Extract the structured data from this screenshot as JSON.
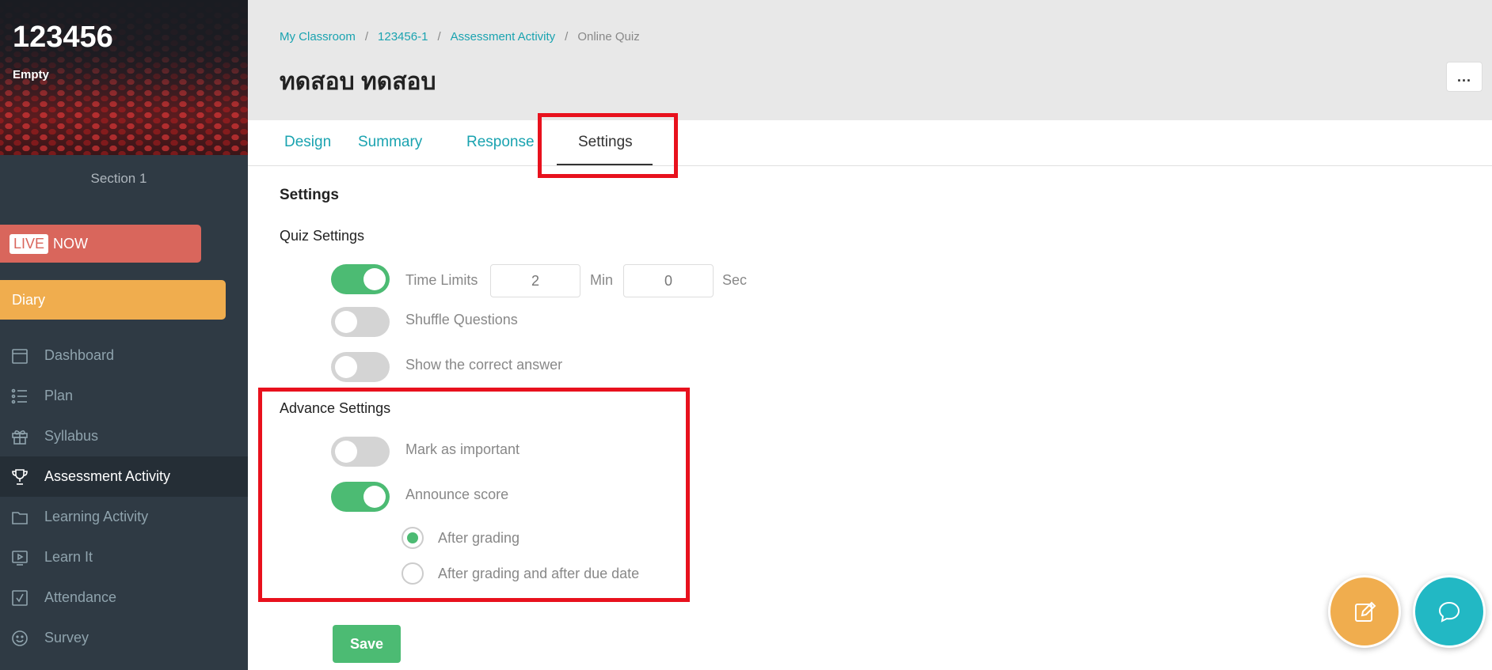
{
  "sidebar": {
    "course_code": "123456",
    "course_subtitle": "Empty",
    "section": "Section 1",
    "live": {
      "tag": "LIVE",
      "label": "NOW",
      "color": "#d9665c"
    },
    "diary": {
      "label": "Diary",
      "color": "#f0ad4e"
    },
    "nav": [
      {
        "label": "Dashboard",
        "icon": "calendar-icon"
      },
      {
        "label": "Plan",
        "icon": "list-icon"
      },
      {
        "label": "Syllabus",
        "icon": "gift-icon"
      },
      {
        "label": "Assessment Activity",
        "icon": "trophy-icon",
        "active": true
      },
      {
        "label": "Learning Activity",
        "icon": "folder-icon"
      },
      {
        "label": "Learn It",
        "icon": "play-icon"
      },
      {
        "label": "Attendance",
        "icon": "checkbox-icon"
      },
      {
        "label": "Survey",
        "icon": "smiley-icon"
      }
    ]
  },
  "header": {
    "breadcrumb": [
      "My Classroom",
      "123456-1",
      "Assessment Activity",
      "Online Quiz"
    ],
    "title": "ทดสอบ ทดสอบ",
    "more_label": "..."
  },
  "tabs": [
    {
      "label": "Design"
    },
    {
      "label": "Summary"
    },
    {
      "label": "Response"
    },
    {
      "label": "Settings",
      "active": true
    }
  ],
  "settings": {
    "heading": "Settings",
    "quiz_heading": "Quiz Settings",
    "time_limits": {
      "label": "Time Limits",
      "enabled": true,
      "minutes": "2",
      "min_unit": "Min",
      "seconds": "0",
      "sec_unit": "Sec"
    },
    "shuffle": {
      "label": "Shuffle Questions",
      "enabled": false
    },
    "show_answer": {
      "label": "Show the correct answer",
      "enabled": false
    },
    "advance_heading": "Advance Settings",
    "mark_important": {
      "label": "Mark as important",
      "enabled": false
    },
    "announce_score": {
      "label": "Announce score",
      "enabled": true
    },
    "announce_options": [
      {
        "label": "After grading",
        "selected": true
      },
      {
        "label": "After grading and after due date",
        "selected": false
      }
    ],
    "save_label": "Save"
  },
  "colors": {
    "accent": "#1aa3b0",
    "toggle_on": "#4cbb73",
    "highlight": "#e8111d",
    "fab_edit": "#f0ad4e",
    "fab_chat": "#22b8c4"
  }
}
